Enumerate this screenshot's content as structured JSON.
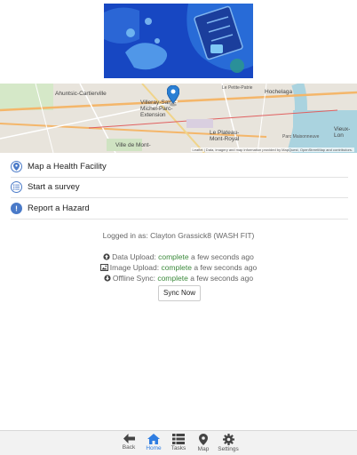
{
  "menu": {
    "items": [
      {
        "label": "Map a Health Facility",
        "icon": "map-marker-icon"
      },
      {
        "label": "Start a survey",
        "icon": "list-icon"
      },
      {
        "label": "Report a Hazard",
        "icon": "warning-icon"
      }
    ]
  },
  "map": {
    "labels": [
      "Ahuntsic-Cartierville",
      "Villeray-Saint-Michel-Parc-Extension",
      "Ville de Mont-",
      "Le Plateau-Mont-Royal",
      "Hochelaga",
      "Vieux-Lon",
      "Le Petite-Patrie",
      "Parc Maisonneuve"
    ],
    "attribution": "Leaflet | Data, imagery and map information provided by MapQuest, OpenStreetMap and contributors."
  },
  "status": {
    "logged_in_prefix": "Logged in as:",
    "user": "Clayton Grassick8 (WASH FIT)",
    "data_upload_label": "Data Upload:",
    "data_upload_status": "complete",
    "data_upload_time": "a few seconds ago",
    "image_upload_label": "Image Upload:",
    "image_upload_status": "complete",
    "image_upload_time": "a few seconds ago",
    "offline_sync_label": "Offline Sync:",
    "offline_sync_status": "complete",
    "offline_sync_time": "a few seconds ago"
  },
  "sync_button": "Sync Now",
  "tabbar": {
    "tabs": [
      {
        "label": "Back",
        "icon": "back-arrow-icon"
      },
      {
        "label": "Home",
        "icon": "home-icon",
        "active": true
      },
      {
        "label": "Tasks",
        "icon": "tasks-list-icon"
      },
      {
        "label": "Map",
        "icon": "map-pin-icon"
      },
      {
        "label": "Settings",
        "icon": "gear-icon"
      }
    ]
  },
  "colors": {
    "accent": "#2f7de1",
    "complete": "#3c8a3c",
    "hero_blue": "#1747c2"
  }
}
